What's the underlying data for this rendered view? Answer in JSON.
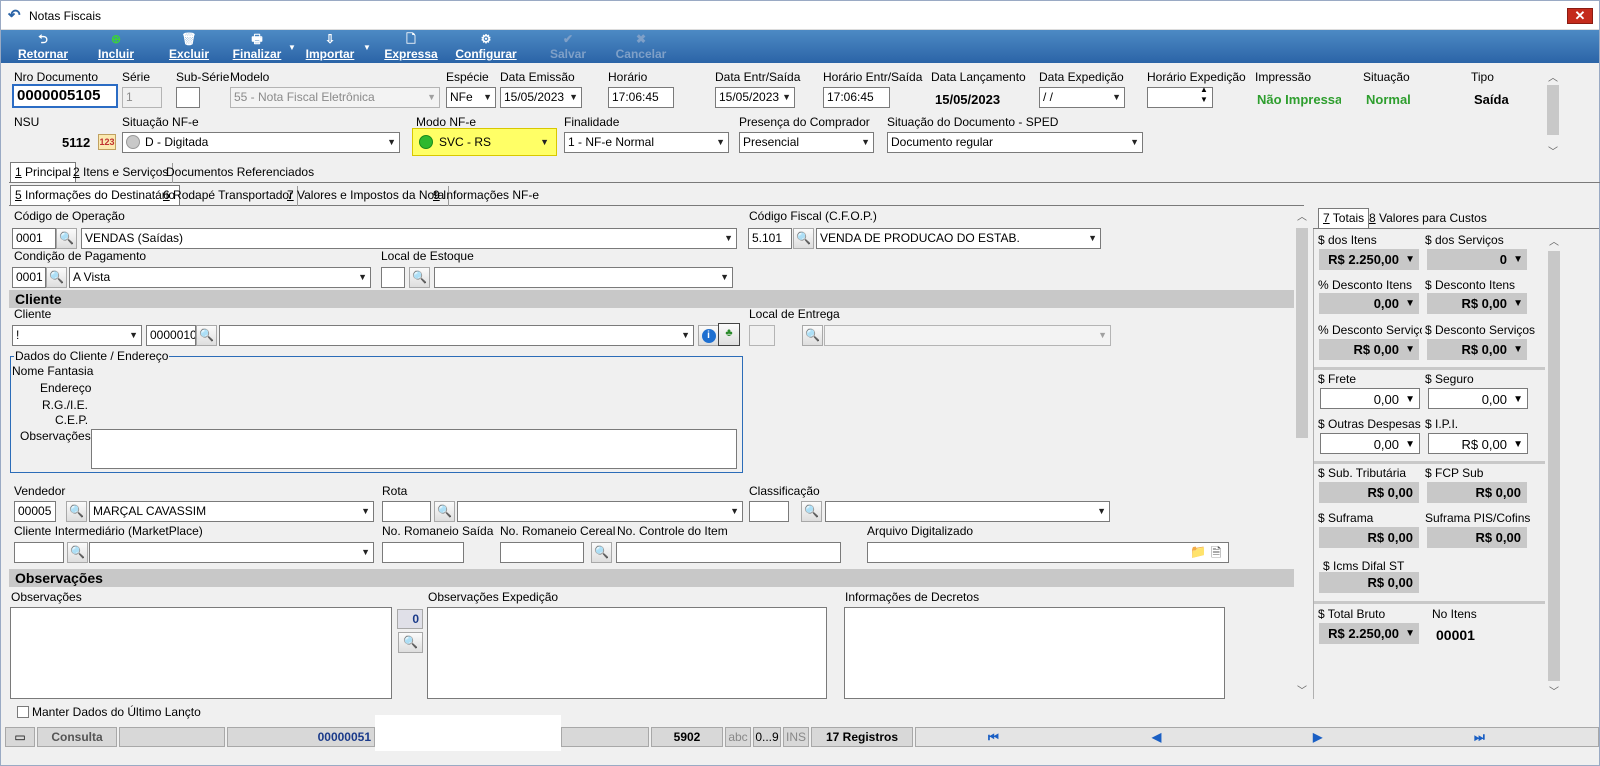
{
  "window": {
    "title": "Notas Fiscais",
    "close_label": "✕"
  },
  "toolbar": {
    "retornar": "Retornar",
    "incluir": "Incluir",
    "excluir": "Excluir",
    "finalizar": "Finalizar",
    "importar": "Importar",
    "expressa": "Expressa",
    "configurar": "Configurar",
    "salvar": "Salvar",
    "cancelar": "Cancelar"
  },
  "header": {
    "nro_documento_label": "Nro Documento",
    "nro_documento": "0000005105",
    "serie_label": "Série",
    "serie": "1",
    "subserie_label": "Sub-Série",
    "subserie": "",
    "modelo_label": "Modelo",
    "modelo": "55 - Nota Fiscal Eletrônica",
    "especie_label": "Espécie",
    "especie": "NFe",
    "data_emissao_label": "Data Emissão",
    "data_emissao": "15/05/2023",
    "horario_label": "Horário",
    "horario": "17:06:45",
    "data_entr_label": "Data Entr/Saída",
    "data_entr": "15/05/2023",
    "horario_entr_label": "Horário Entr/Saída",
    "horario_entr": "17:06:45",
    "data_lanc_label": "Data Lançamento",
    "data_lanc": "15/05/2023",
    "data_exped_label": "Data Expedição",
    "data_exped": " / /",
    "horario_exped_label": "Horário Expedição",
    "horario_exped": "",
    "impressao_label": "Impressão",
    "impressao": "Não Impressa",
    "situacao_label": "Situação",
    "situacao": "Normal",
    "tipo_label": "Tipo",
    "tipo": "Saída",
    "nsu_label": "NSU",
    "nsu": "5112",
    "situacao_nfe_label": "Situação NF-e",
    "situacao_nfe": "D - Digitada",
    "modo_nfe_label": "Modo NF-e",
    "modo_nfe": "SVC - RS",
    "finalidade_label": "Finalidade",
    "finalidade": "1 - NF-e Normal",
    "presenca_label": "Presença do Comprador",
    "presenca": "Presencial",
    "sit_sped_label": "Situação do Documento - SPED",
    "sit_sped": "Documento regular"
  },
  "tabs_main": [
    {
      "key": "1",
      "label": " Principal"
    },
    {
      "key": "2",
      "label": " Itens e Serviços"
    },
    {
      "key": "",
      "label": "Documentos Referenciados"
    }
  ],
  "tabs_sub": [
    {
      "key": "5",
      "label": " Informações do Destinatário"
    },
    {
      "key": "6",
      "label": " Rodapé Transportador"
    },
    {
      "key": "7",
      "label": " Valores e Impostos da Nota"
    },
    {
      "key": "9",
      "label": " Informações NF-e"
    }
  ],
  "form": {
    "cod_op_label": "Código de Operação",
    "cod_op": "0001",
    "cod_op_desc": "VENDAS (Saídas)",
    "cfop_label": "Código Fiscal (C.F.O.P.)",
    "cfop": "5.101",
    "cfop_desc": "VENDA DE PRODUCAO DO ESTAB.",
    "cond_pag_label": "Condição de Pagamento",
    "cond_pag": "0001",
    "cond_pag_desc": "A Vista",
    "local_estoque_label": "Local de Estoque",
    "cliente_section": "Cliente",
    "cliente_label": "Cliente",
    "cliente_tipo": "!",
    "cliente_cod": "0000010",
    "cliente_nome": "",
    "local_entrega_label": "Local de Entrega",
    "dados_cliente_title": "Dados do Cliente / Endereço",
    "nome_fantasia_label": "Nome Fantasia",
    "endereco_label": "Endereço",
    "rg_label": "R.G./I.E.",
    "cep_label": "C.E.P.",
    "obs_cliente_label": "Observações",
    "vendedor_label": "Vendedor",
    "vendedor_cod": "00005",
    "vendedor_nome": "MARÇAL CAVASSIM",
    "rota_label": "Rota",
    "classificacao_label": "Classificação",
    "cliente_interm_label": "Cliente Intermediário (MarketPlace)",
    "romaneio_saida_label": "No. Romaneio Saída",
    "romaneio_cereal_label": "No. Romaneio Cereal",
    "controle_item_label": "No. Controle do Item",
    "arquivo_label": "Arquivo Digitalizado",
    "obs_section": "Observações",
    "obs_label": "Observações",
    "obs_count": "0",
    "obs_exped_label": "Observações Expedição",
    "info_decretos_label": "Informações de Decretos",
    "manter_label": "Manter Dados do Último Lançto"
  },
  "totals": {
    "tabs": [
      {
        "key": "7",
        "label": " Totais"
      },
      {
        "key": "8",
        "label": " Valores para Custos"
      }
    ],
    "dos_itens_label": "$ dos Itens",
    "dos_itens": "R$ 2.250,00",
    "dos_servicos_label": "$ dos Serviços",
    "dos_servicos": "0",
    "pct_desc_itens_label": "% Desconto Itens",
    "pct_desc_itens": "0,00",
    "desc_itens_label": "$ Desconto Itens",
    "desc_itens": "R$ 0,00",
    "pct_desc_serv_label": "% Desconto Serviços",
    "pct_desc_serv": "R$ 0,00",
    "desc_serv_label": "$ Desconto Serviços",
    "desc_serv": "R$ 0,00",
    "frete_label": "$ Frete",
    "frete": "0,00",
    "seguro_label": "$ Seguro",
    "seguro": "0,00",
    "outras_label": "$ Outras Despesas",
    "outras": "0,00",
    "ipi_label": "$ I.P.I.",
    "ipi": "R$ 0,00",
    "sub_trib_label": "$ Sub. Tributária",
    "sub_trib": "R$ 0,00",
    "fcp_sub_label": "$ FCP Sub",
    "fcp_sub": "R$ 0,00",
    "suframa_label": "$ Suframa",
    "suframa": "R$ 0,00",
    "suframa_pis_label": "Suframa PIS/Cofins",
    "suframa_pis": "R$ 0,00",
    "icms_difal_label": "$ Icms Difal ST",
    "icms_difal": "R$ 0,00",
    "total_bruto_label": "$ Total Bruto",
    "total_bruto": "R$ 2.250,00",
    "no_itens_label": "No Itens",
    "no_itens": "00001"
  },
  "status": {
    "mode": "Consulta",
    "doc": "00000051",
    "code": "5902",
    "abc": "abc",
    "num": "0...9",
    "ins": "INS",
    "registros": "17 Registros"
  }
}
